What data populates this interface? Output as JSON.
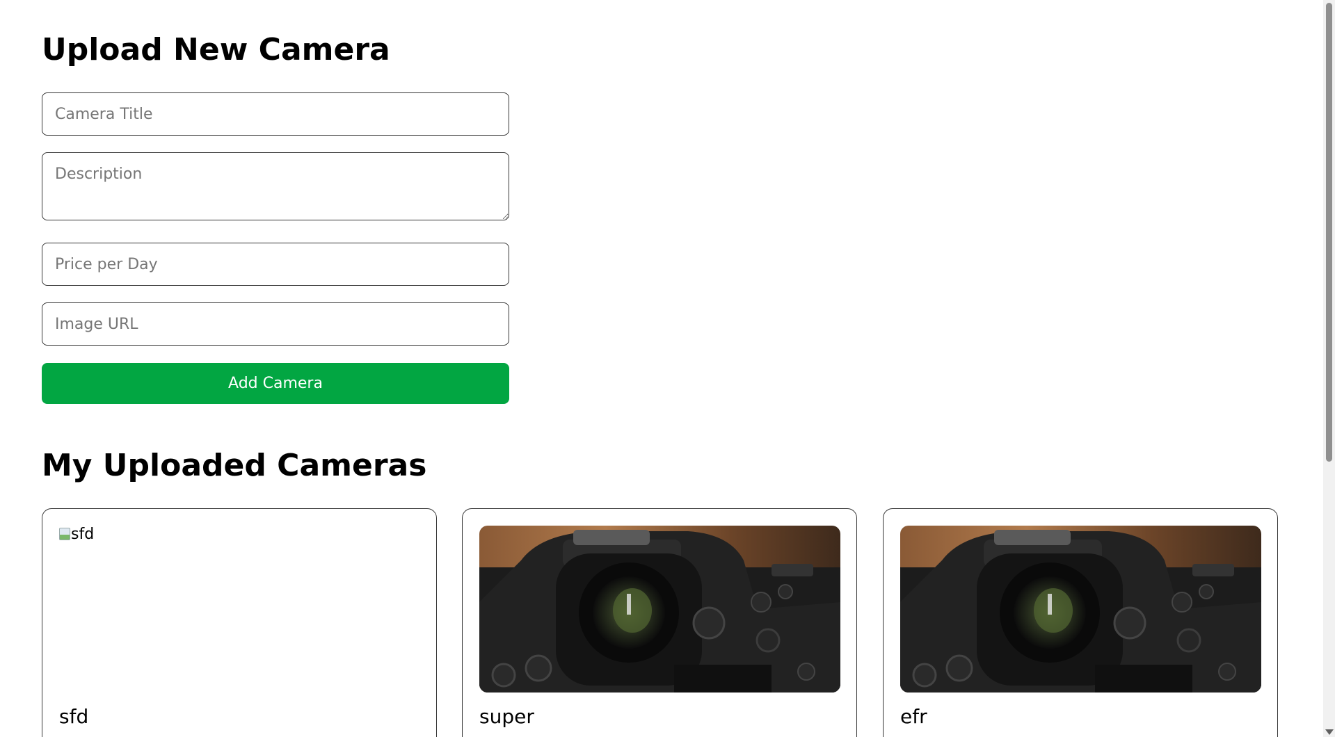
{
  "upload_form": {
    "heading": "Upload New Camera",
    "title_placeholder": "Camera Title",
    "description_placeholder": "Description",
    "price_placeholder": "Price per Day",
    "image_url_placeholder": "Image URL",
    "submit_label": "Add Camera"
  },
  "my_cameras": {
    "heading": "My Uploaded Cameras",
    "items": [
      {
        "name": "sfd",
        "image_alt": "sfd",
        "image_loaded": false
      },
      {
        "name": "super",
        "image_alt": "super",
        "image_loaded": true
      },
      {
        "name": "efr",
        "image_alt": "efr",
        "image_loaded": true
      }
    ]
  },
  "colors": {
    "accent_button": "#02a642",
    "border": "#333333"
  }
}
